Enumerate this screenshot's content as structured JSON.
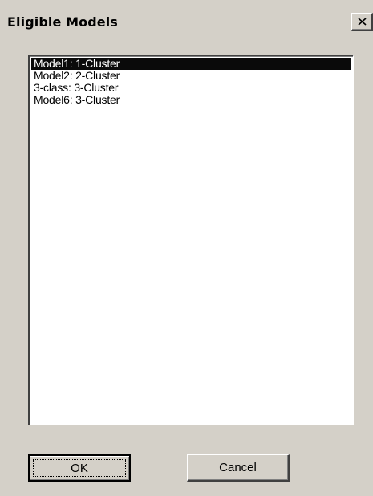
{
  "window": {
    "title": "Eligible Models",
    "close_icon": "close-icon"
  },
  "models_list": {
    "items": [
      "Model1: 1-Cluster",
      "Model2: 2-Cluster",
      "3-class: 3-Cluster",
      "Model6: 3-Cluster"
    ],
    "selected_index": 0
  },
  "buttons": {
    "ok_label": "OK",
    "cancel_label": "Cancel"
  },
  "colors": {
    "dialog_bg": "#d4d0c8",
    "list_bg": "#ffffff",
    "selection_bg": "#0a0a0a",
    "selection_text": "#ffffff"
  }
}
